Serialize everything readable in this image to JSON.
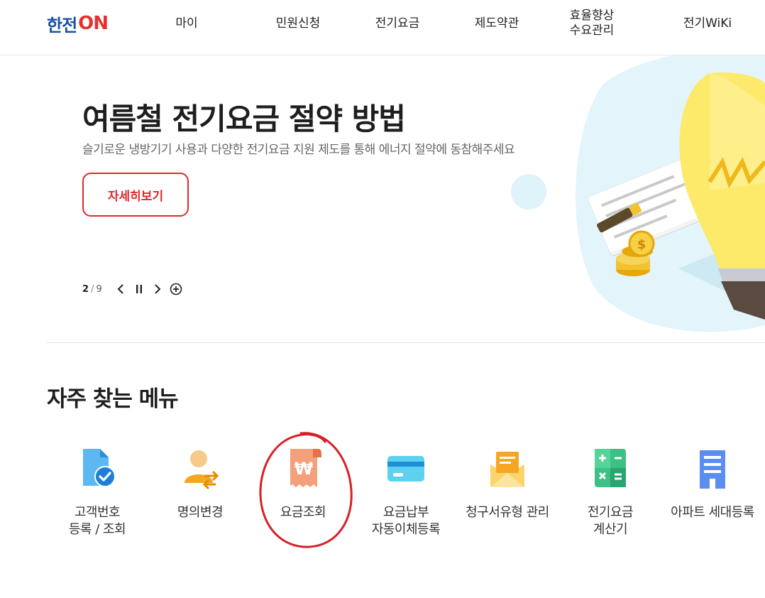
{
  "header": {
    "logo": {
      "main": "한전",
      "on": "ON"
    },
    "nav": [
      {
        "label": "마이"
      },
      {
        "label": "민원신청"
      },
      {
        "label": "전기요금"
      },
      {
        "label": "제도약관"
      },
      {
        "label": "효율향상\n수요관리"
      },
      {
        "label": "전기WiKi"
      }
    ]
  },
  "hero": {
    "title": "여름철 전기요금 절약 방법",
    "subtitle": "슬기로운 냉방기기 사용과 다양한 전기요금 지원 제도를 통해 에너지 절약에 동참해주세요",
    "button_label": "자세히보기",
    "slide_current": "2",
    "slide_separator": "/",
    "slide_total": "9"
  },
  "quick_menu": {
    "title": "자주 찾는 메뉴",
    "items": [
      {
        "label": "고객번호\n등록 / 조회",
        "icon": "customer-number-icon"
      },
      {
        "label": "명의변경",
        "icon": "name-change-icon"
      },
      {
        "label": "요금조회",
        "icon": "bill-inquiry-icon"
      },
      {
        "label": "요금납부\n자동이체등록",
        "icon": "card-payment-icon"
      },
      {
        "label": "청구서유형 관리",
        "icon": "bill-envelope-icon"
      },
      {
        "label": "전기요금\n계산기",
        "icon": "calculator-icon"
      },
      {
        "label": "아파트 세대등록",
        "icon": "apartment-icon"
      }
    ]
  },
  "colors": {
    "brand_blue": "#1b4fa8",
    "brand_red": "#e5322d",
    "annotation_red": "#d91f26"
  }
}
